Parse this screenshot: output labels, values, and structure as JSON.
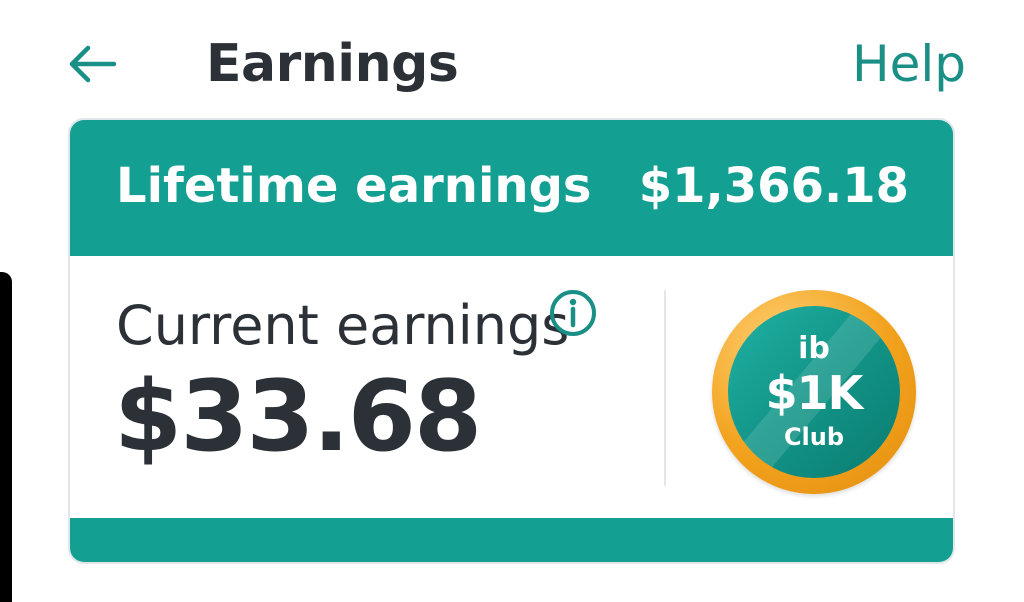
{
  "header": {
    "title": "Earnings",
    "help_label": "Help",
    "back_icon": "arrow-left-icon"
  },
  "earnings_card": {
    "lifetime_label": "Lifetime earnings",
    "lifetime_value": "$1,366.18",
    "current_label": "Current earnings",
    "current_value": "$33.68",
    "info_icon": "info-icon",
    "badge": {
      "top": "ib",
      "amount": "$1K",
      "bottom": "Club"
    }
  },
  "colors": {
    "accent": "#13a092",
    "help_link": "#1a8f86",
    "text": "#2b3137",
    "badge_ring": "#f2a21c"
  }
}
